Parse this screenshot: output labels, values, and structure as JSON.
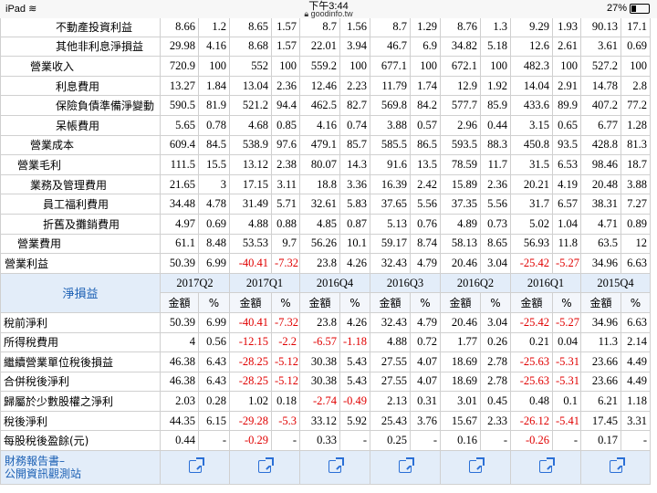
{
  "status_bar": {
    "device": "iPad",
    "time": "下午3:44",
    "url": "goodinfo.tw",
    "battery": "27%",
    "battery_level": 0.27
  },
  "top_rows": [
    {
      "label": "不動產投資利益",
      "indent": 2,
      "values": [
        "8.66",
        "1.2",
        "8.65",
        "1.57",
        "8.7",
        "1.56",
        "8.7",
        "1.29",
        "8.76",
        "1.3",
        "9.29",
        "1.93",
        "90.13",
        "17.1"
      ]
    },
    {
      "label": "其他非利息淨損益",
      "indent": 2,
      "values": [
        "29.98",
        "4.16",
        "8.68",
        "1.57",
        "22.01",
        "3.94",
        "46.7",
        "6.9",
        "34.82",
        "5.18",
        "12.6",
        "2.61",
        "3.61",
        "0.69"
      ]
    },
    {
      "label": "營業收入",
      "indent": 1,
      "values": [
        "720.9",
        "100",
        "552",
        "100",
        "559.2",
        "100",
        "677.1",
        "100",
        "672.1",
        "100",
        "482.3",
        "100",
        "527.2",
        "100"
      ]
    },
    {
      "label": "利息費用",
      "indent": 2,
      "values": [
        "13.27",
        "1.84",
        "13.04",
        "2.36",
        "12.46",
        "2.23",
        "11.79",
        "1.74",
        "12.9",
        "1.92",
        "14.04",
        "2.91",
        "14.78",
        "2.8"
      ]
    },
    {
      "label": "保險負債準備淨變動",
      "indent": 2,
      "values": [
        "590.5",
        "81.9",
        "521.2",
        "94.4",
        "462.5",
        "82.7",
        "569.8",
        "84.2",
        "577.7",
        "85.9",
        "433.6",
        "89.9",
        "407.2",
        "77.2"
      ]
    },
    {
      "label": "呆帳費用",
      "indent": 2,
      "values": [
        "5.65",
        "0.78",
        "4.68",
        "0.85",
        "4.16",
        "0.74",
        "3.88",
        "0.57",
        "2.96",
        "0.44",
        "3.15",
        "0.65",
        "6.77",
        "1.28"
      ]
    },
    {
      "label": "營業成本",
      "indent": 1,
      "values": [
        "609.4",
        "84.5",
        "538.9",
        "97.6",
        "479.1",
        "85.7",
        "585.5",
        "86.5",
        "593.5",
        "88.3",
        "450.8",
        "93.5",
        "428.8",
        "81.3"
      ]
    },
    {
      "label": "營業毛利",
      "indent": 0.5,
      "values": [
        "111.5",
        "15.5",
        "13.12",
        "2.38",
        "80.07",
        "14.3",
        "91.6",
        "13.5",
        "78.59",
        "11.7",
        "31.5",
        "6.53",
        "98.46",
        "18.7"
      ]
    },
    {
      "label": "業務及管理費用",
      "indent": 1,
      "values": [
        "21.65",
        "3",
        "17.15",
        "3.11",
        "18.8",
        "3.36",
        "16.39",
        "2.42",
        "15.89",
        "2.36",
        "20.21",
        "4.19",
        "20.48",
        "3.88"
      ]
    },
    {
      "label": "員工福利費用",
      "indent": 1.5,
      "values": [
        "34.48",
        "4.78",
        "31.49",
        "5.71",
        "32.61",
        "5.83",
        "37.65",
        "5.56",
        "37.35",
        "5.56",
        "31.7",
        "6.57",
        "38.31",
        "7.27"
      ]
    },
    {
      "label": "折舊及攤銷費用",
      "indent": 1.5,
      "values": [
        "4.97",
        "0.69",
        "4.88",
        "0.88",
        "4.85",
        "0.87",
        "5.13",
        "0.76",
        "4.89",
        "0.73",
        "5.02",
        "1.04",
        "4.71",
        "0.89"
      ]
    },
    {
      "label": "營業費用",
      "indent": 0.5,
      "values": [
        "61.1",
        "8.48",
        "53.53",
        "9.7",
        "56.26",
        "10.1",
        "59.17",
        "8.74",
        "58.13",
        "8.65",
        "56.93",
        "11.8",
        "63.5",
        "12"
      ]
    },
    {
      "label": "營業利益",
      "indent": 0,
      "values": [
        "50.39",
        "6.99",
        "-40.41",
        "-7.32",
        "23.8",
        "4.26",
        "32.43",
        "4.79",
        "20.46",
        "3.04",
        "-25.42",
        "-5.27",
        "34.96",
        "6.63"
      ]
    }
  ],
  "section": {
    "title": "淨損益",
    "quarters": [
      "2017Q2",
      "2017Q1",
      "2016Q4",
      "2016Q3",
      "2016Q2",
      "2016Q1",
      "2015Q4"
    ],
    "amount_label": "金額",
    "pct_label": "%"
  },
  "bottom_rows": [
    {
      "label": "稅前淨利",
      "values": [
        "50.39",
        "6.99",
        "-40.41",
        "-7.32",
        "23.8",
        "4.26",
        "32.43",
        "4.79",
        "20.46",
        "3.04",
        "-25.42",
        "-5.27",
        "34.96",
        "6.63"
      ]
    },
    {
      "label": "所得稅費用",
      "values": [
        "4",
        "0.56",
        "-12.15",
        "-2.2",
        "-6.57",
        "-1.18",
        "4.88",
        "0.72",
        "1.77",
        "0.26",
        "0.21",
        "0.04",
        "11.3",
        "2.14"
      ]
    },
    {
      "label": "繼續營業單位稅後損益",
      "values": [
        "46.38",
        "6.43",
        "-28.25",
        "-5.12",
        "30.38",
        "5.43",
        "27.55",
        "4.07",
        "18.69",
        "2.78",
        "-25.63",
        "-5.31",
        "23.66",
        "4.49"
      ]
    },
    {
      "label": "合併稅後淨利",
      "values": [
        "46.38",
        "6.43",
        "-28.25",
        "-5.12",
        "30.38",
        "5.43",
        "27.55",
        "4.07",
        "18.69",
        "2.78",
        "-25.63",
        "-5.31",
        "23.66",
        "4.49"
      ]
    },
    {
      "label": "歸屬於少數股權之淨利",
      "values": [
        "2.03",
        "0.28",
        "1.02",
        "0.18",
        "-2.74",
        "-0.49",
        "2.13",
        "0.31",
        "3.01",
        "0.45",
        "0.48",
        "0.1",
        "6.21",
        "1.18"
      ]
    },
    {
      "label": "稅後淨利",
      "values": [
        "44.35",
        "6.15",
        "-29.28",
        "-5.3",
        "33.12",
        "5.92",
        "25.43",
        "3.76",
        "15.67",
        "2.33",
        "-26.12",
        "-5.41",
        "17.45",
        "3.31"
      ]
    },
    {
      "label": "每股稅後盈餘(元)",
      "values": [
        "0.44",
        "-",
        "-0.29",
        "-",
        "0.33",
        "-",
        "0.25",
        "-",
        "0.16",
        "-",
        "-0.26",
        "-",
        "0.17",
        "-"
      ]
    }
  ],
  "footer": {
    "title_line1": "財務報告書–",
    "title_line2": "公開資訊觀測站",
    "link_icon": "external-link-icon"
  }
}
